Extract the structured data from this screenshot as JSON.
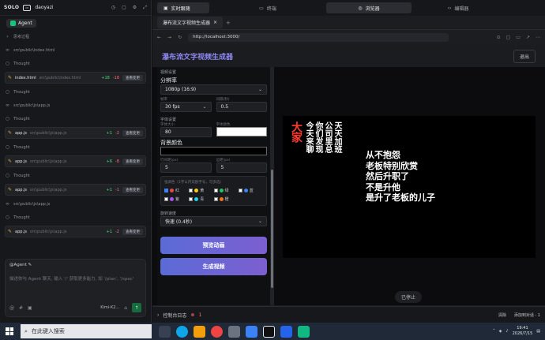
{
  "left": {
    "brand": "SOLO",
    "user": "daoyazi",
    "agent_label": "Agent",
    "feed": [
      {
        "kind": "line",
        "icon": "chevron-right-icon",
        "text": "思考过程"
      },
      {
        "kind": "line",
        "icon": "link-icon",
        "text": "src\\public\\index.html"
      },
      {
        "kind": "line",
        "icon": "thought-icon",
        "text": "Thought"
      },
      {
        "kind": "card",
        "file": "index.html",
        "path": "src\\public\\index.html",
        "plus": "+18",
        "minus": "-18",
        "action": "查看变更"
      },
      {
        "kind": "line",
        "icon": "thought-icon",
        "text": "Thought"
      },
      {
        "kind": "line",
        "icon": "link-icon",
        "text": "src\\public\\js\\app.js"
      },
      {
        "kind": "line",
        "icon": "thought-icon",
        "text": "Thought"
      },
      {
        "kind": "card",
        "file": "app.js",
        "path": "src\\public\\js\\app.js",
        "plus": "+1",
        "minus": "-2",
        "action": "查看变更"
      },
      {
        "kind": "line",
        "icon": "thought-icon",
        "text": "Thought"
      },
      {
        "kind": "card",
        "file": "app.js",
        "path": "src\\public\\js\\app.js",
        "plus": "+6",
        "minus": "-8",
        "action": "查看变更"
      },
      {
        "kind": "line",
        "icon": "thought-icon",
        "text": "Thought"
      },
      {
        "kind": "card",
        "file": "app.js",
        "path": "src\\public\\js\\app.js",
        "plus": "+1",
        "minus": "-1",
        "action": "查看变更"
      },
      {
        "kind": "line",
        "icon": "link-icon",
        "text": "src\\public\\js\\app.js"
      },
      {
        "kind": "line",
        "icon": "thought-icon",
        "text": "Thought"
      },
      {
        "kind": "card",
        "file": "app.js",
        "path": "src\\public\\js\\app.js",
        "plus": "+1",
        "minus": "-2",
        "action": "查看变更"
      }
    ],
    "composer": {
      "mention": "@Agent ✎",
      "placeholder": "描述你与 Agent 聊天, 输入 '/' 获取更多能力, 如 '/plan', '/spec'",
      "model": "Kimi-K2..."
    }
  },
  "tabs": [
    "实时跟随",
    "终端",
    "浏览器",
    "编辑器"
  ],
  "content_tab": "瀑布流文字视频生成器",
  "address": "http://localhost:3000/",
  "app": {
    "title": "瀑布流文字视频生成器",
    "exit": "退出",
    "video_settings": "视频设置",
    "resolution_label": "分辨率",
    "resolution_value": "1080p (16:9)",
    "fps_label": "帧率",
    "fps_value": "30 fps",
    "interval_label": "间隔(秒)",
    "interval_value": "0.5",
    "font_settings": "字体设置",
    "font_size_label": "字体大小",
    "font_size_value": "80",
    "font_color_label": "字体颜色",
    "bg_color_label": "背景颜色",
    "line_spacing_label": "行间距(px)",
    "line_spacing_value": "5",
    "margin_label": "边距(px)",
    "margin_value": "5",
    "highlight_label": "强调色（1字以内双欧字号，可多选）",
    "highlights": [
      {
        "name": "红",
        "checked": true,
        "color": "#ef4444"
      },
      {
        "name": "黄",
        "checked": false,
        "color": "#facc15"
      },
      {
        "name": "绿",
        "checked": false,
        "color": "#22c55e"
      },
      {
        "name": "蓝",
        "checked": false,
        "color": "#3b82f6"
      },
      {
        "name": "紫",
        "checked": false,
        "color": "#a855f7"
      },
      {
        "name": "青",
        "checked": false,
        "color": "#22d3ee"
      },
      {
        "name": "橙",
        "checked": false,
        "color": "#f97316"
      }
    ],
    "rotate_label": "旋转速度",
    "rotate_value": "快速 (0.4秒)",
    "preview_button": "预览动画",
    "generate_button": "生成视频",
    "stopped": "已停止"
  },
  "preview": {
    "red_word": "大家",
    "vertical_cols": [
      "今天来聊",
      "你们发现",
      "公司里总",
      "天天加班"
    ],
    "horizontal_lines": [
      "从不抱怨",
      "老板特别欣赏",
      "然后升职了",
      "不是升他",
      "是升了老板的儿子"
    ]
  },
  "console": {
    "label": "控制台日志",
    "errors": "1",
    "clear": "清除",
    "add": "添加到对话 - 1"
  },
  "taskbar": {
    "search": "在此键入搜索",
    "time": "19:41",
    "date": "2026/7/15"
  }
}
